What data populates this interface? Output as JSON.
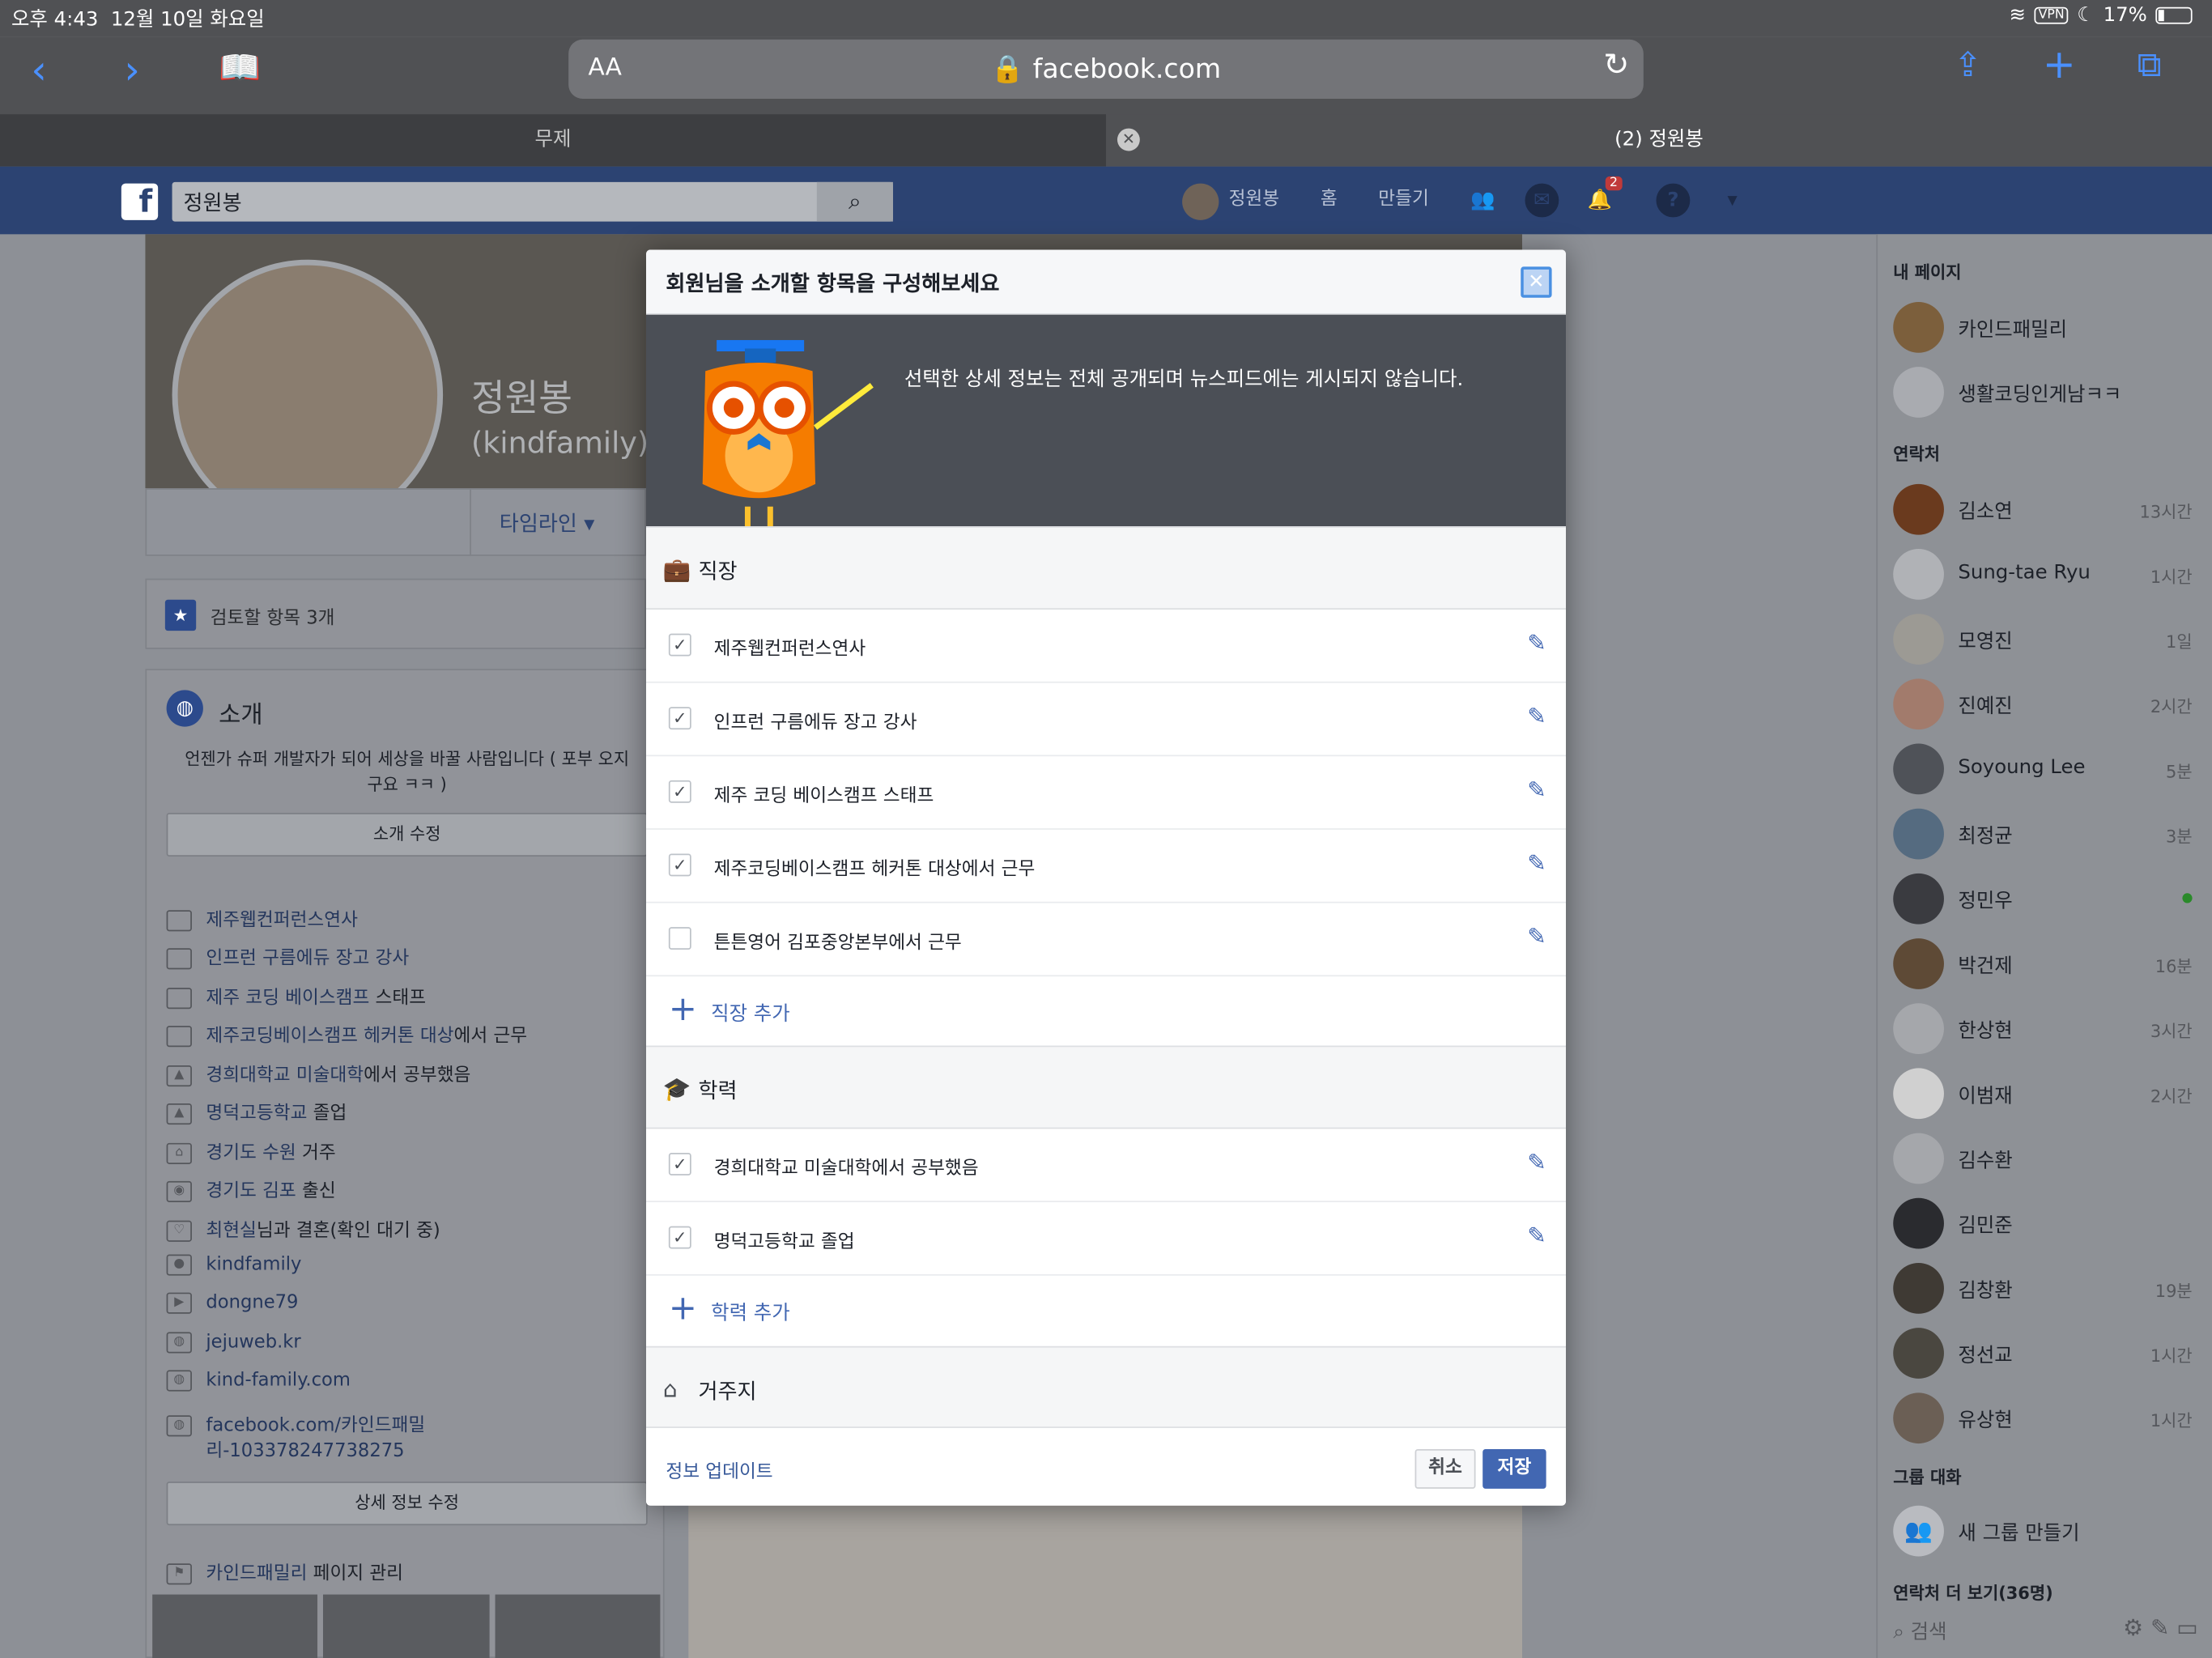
{
  "status_bar": {
    "time": "오후 4:43",
    "date": "12월 10일 화요일",
    "vpn": "VPN",
    "battery": "17%"
  },
  "browser": {
    "text_size_label": "AA",
    "url": "facebook.com",
    "tabs": [
      {
        "label": "무제"
      },
      {
        "label": "(2) 정원봉"
      }
    ]
  },
  "fb_header": {
    "search_value": "정원봉",
    "profile_name": "정원봉",
    "home_label": "홈",
    "create_label": "만들기",
    "notification_count": "2"
  },
  "profile": {
    "name": "정원봉",
    "handle": "(kindfamily)",
    "timeline_label": "타임라인",
    "review_label": "검토할 항목 3개",
    "intro_title": "소개",
    "bio": "언젠가 슈퍼 개발자가 되어 세상을 바꿀 사람입니다 ( 포부 오지구요 ㅋㅋ )",
    "edit_intro_label": "소개 수정",
    "edit_details_label": "상세 정보 수정",
    "manage_page_link": "카인드패밀리",
    "manage_page_text": " 페이지 관리",
    "items": [
      {
        "link": "제주웹컨퍼런스연사",
        "text": ""
      },
      {
        "link": "인프런 구름에듀 장고 강사",
        "text": ""
      },
      {
        "link": "제주 코딩 베이스캠프",
        "text": " 스태프"
      },
      {
        "link": "제주코딩베이스캠프 헤커톤 대상",
        "text": "에서 근무"
      },
      {
        "link": "경희대학교 미술대학",
        "text": "에서 공부했음"
      },
      {
        "link": "명덕고등학교",
        "text": " 졸업"
      },
      {
        "link": "경기도 수원",
        "text": " 거주"
      },
      {
        "link": "경기도 김포",
        "text": " 출신"
      },
      {
        "link": "최현실",
        "text": "님과 결혼(확인 대기 중)"
      },
      {
        "link": "kindfamily",
        "text": ""
      },
      {
        "link": "dongne79",
        "text": ""
      },
      {
        "link": "jejuweb.kr",
        "text": ""
      },
      {
        "link": "kind-family.com",
        "text": ""
      },
      {
        "link": "facebook.com/카인드패밀",
        "text": ""
      }
    ],
    "items_extra_line": "리-103378247738275"
  },
  "sidebar": {
    "my_pages_label": "내 페이지",
    "pages": [
      "카인드패밀리",
      "생활코딩인게남ㅋㅋ"
    ],
    "contacts_label": "연락처",
    "contacts": [
      {
        "name": "김소연",
        "time": "13시간"
      },
      {
        "name": "Sung-tae Ryu",
        "time": "1시간"
      },
      {
        "name": "모영진",
        "time": "1일"
      },
      {
        "name": "진예진",
        "time": "2시간"
      },
      {
        "name": "Soyoung Lee",
        "time": "5분"
      },
      {
        "name": "최정균",
        "time": "3분"
      },
      {
        "name": "정민우",
        "time": ""
      },
      {
        "name": "박건제",
        "time": "16분"
      },
      {
        "name": "한상현",
        "time": "3시간"
      },
      {
        "name": "이범재",
        "time": "2시간"
      },
      {
        "name": "김수환",
        "time": ""
      },
      {
        "name": "김민준",
        "time": ""
      },
      {
        "name": "김창환",
        "time": "19분"
      },
      {
        "name": "정선교",
        "time": "1시간"
      },
      {
        "name": "유상현",
        "time": "1시간"
      }
    ],
    "group_chat_label": "그룹 대화",
    "new_group_label": "새 그룹 만들기",
    "more_contacts_label": "연락처 더 보기(36명)",
    "search_placeholder": "검색"
  },
  "modal": {
    "title": "회원님을 소개할 항목을 구성해보세요",
    "banner_text": "선택한 상세 정보는 전체 공개되며 뉴스피드에는 게시되지 않습니다.",
    "work_section_title": "직장",
    "work_items": [
      {
        "label": "제주웹컨퍼런스연사",
        "checked": true
      },
      {
        "label": "인프런 구름에듀 장고 강사",
        "checked": true
      },
      {
        "label": "제주 코딩 베이스캠프 스태프",
        "checked": true
      },
      {
        "label": "제주코딩베이스캠프 헤커톤 대상에서 근무",
        "checked": true
      },
      {
        "label": "튼튼영어 김포중앙본부에서 근무",
        "checked": false
      }
    ],
    "add_work_label": "직장 추가",
    "education_section_title": "학력",
    "education_items": [
      {
        "label": "경희대학교 미술대학에서 공부했음",
        "checked": true
      },
      {
        "label": "명덕고등학교 졸업",
        "checked": true
      }
    ],
    "add_education_label": "학력 추가",
    "residence_section_title": "거주지",
    "update_link": "정보 업데이트",
    "cancel_label": "취소",
    "save_label": "저장"
  },
  "colors": {
    "facebook_blue": "#4267b2",
    "fb_header": "#3b5998",
    "ios_blue": "#0a84ff"
  }
}
